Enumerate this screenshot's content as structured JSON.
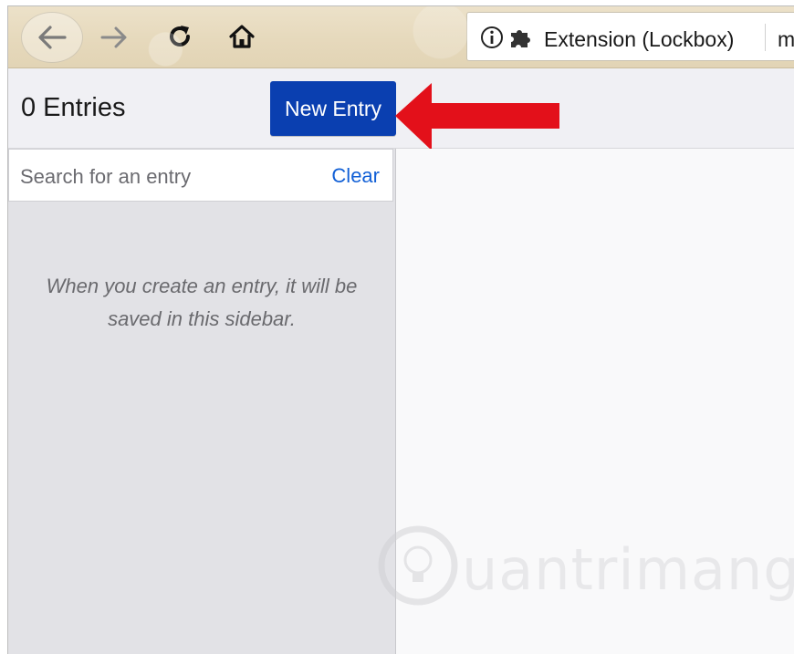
{
  "browser": {
    "url_text": "Extension (Lockbox)",
    "url_overflow_text": "m",
    "icons": {
      "back": "back-arrow-icon",
      "forward": "forward-arrow-icon",
      "reload": "reload-icon",
      "home": "home-icon",
      "info": "info-icon",
      "extension": "puzzle-piece-icon"
    }
  },
  "header": {
    "entries_count": "0 Entries",
    "new_entry_label": "New Entry",
    "accent_color": "#0a3fb0",
    "annotation_arrow_color": "#e3101a"
  },
  "sidebar": {
    "search": {
      "placeholder": "Search for an entry",
      "value": ""
    },
    "clear_label": "Clear",
    "empty_message": "When you create an entry, it will be saved in this sidebar."
  },
  "watermark": {
    "text": "uantrimang"
  }
}
